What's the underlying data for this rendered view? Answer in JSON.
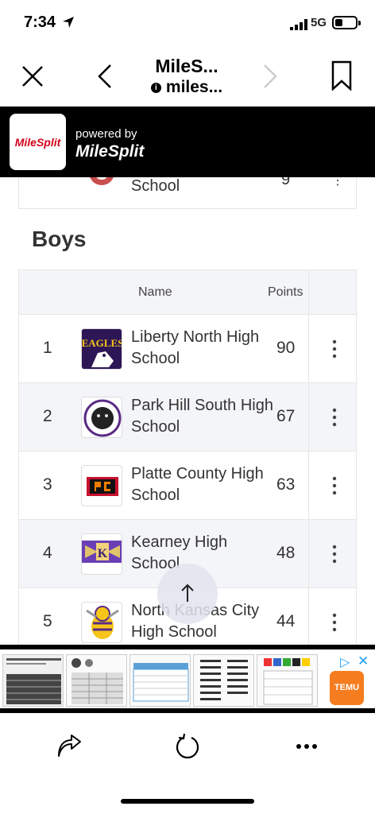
{
  "status_bar": {
    "time": "7:34",
    "network": "5G"
  },
  "nav": {
    "title": "MileS...",
    "url": "miles..."
  },
  "banner": {
    "logo_text": "MileSplit",
    "powered_by": "powered by",
    "brand": "MileSplit"
  },
  "previous_row": {
    "name": "School"
  },
  "section": {
    "title": "Boys"
  },
  "table": {
    "header": {
      "name": "Name",
      "points": "Points"
    },
    "rows": [
      {
        "rank": "1",
        "name": "Liberty North High School",
        "points": "90"
      },
      {
        "rank": "2",
        "name": "Park Hill South High School",
        "points": "67"
      },
      {
        "rank": "3",
        "name": "Platte County High School",
        "points": "63"
      },
      {
        "rank": "4",
        "name": "Kearney High School",
        "points": "48"
      },
      {
        "rank": "5",
        "name": "North Kansas City High School",
        "points": "44"
      }
    ]
  },
  "ad": {
    "brand": "TEMU"
  },
  "colors": {
    "brand_red": "#d0021b",
    "temu_orange": "#f57c1f",
    "ad_blue": "#1ea1f2"
  }
}
